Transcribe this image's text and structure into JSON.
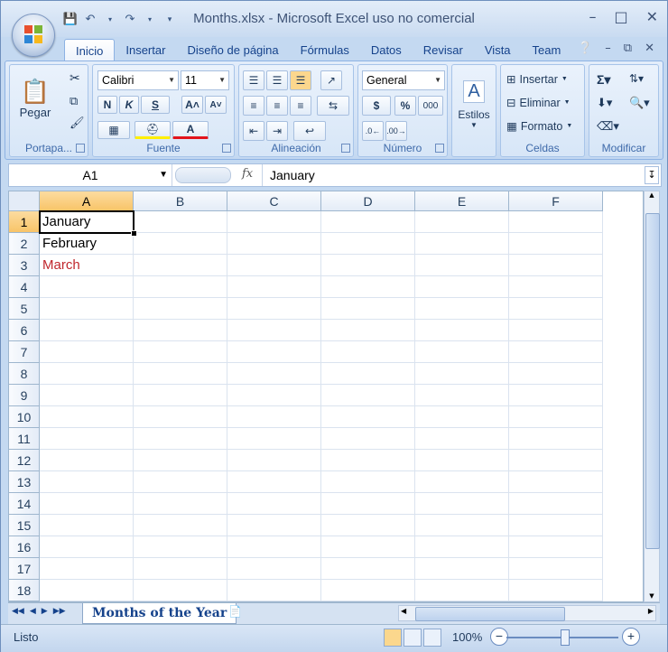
{
  "window": {
    "title": "Months.xlsx - Microsoft Excel uso no comercial",
    "controls": [
      "–",
      "□",
      "✕"
    ]
  },
  "qat": {
    "save_icon": "save-icon",
    "undo_icon": "undo-icon",
    "redo_icon": "redo-icon"
  },
  "tabs": [
    {
      "label": "Inicio",
      "active": true
    },
    {
      "label": "Insertar"
    },
    {
      "label": "Diseño de página"
    },
    {
      "label": "Fórmulas"
    },
    {
      "label": "Datos"
    },
    {
      "label": "Revisar"
    },
    {
      "label": "Vista"
    },
    {
      "label": "Team"
    }
  ],
  "ribbon": {
    "clipboard": {
      "label": "Portapa...",
      "paste": "Pegar"
    },
    "font": {
      "label": "Fuente",
      "name": "Calibri",
      "size": "11",
      "bold": "N",
      "italic": "K",
      "underline": "S"
    },
    "alignment": {
      "label": "Alineación"
    },
    "number": {
      "label": "Número",
      "format": "General",
      "currency": "$",
      "percent": "%",
      "thousands": "000",
      "inc_decimal": "←,0\n.00",
      "dec_decimal": ",00\n→,0"
    },
    "styles": {
      "label": "Estilos"
    },
    "cells": {
      "label": "Celdas",
      "insert": "Insertar",
      "delete": "Eliminar",
      "format": "Formato"
    },
    "editing": {
      "label": "Modificar"
    }
  },
  "formula_bar": {
    "name_box": "A1",
    "fx": "fx",
    "content": "January"
  },
  "grid": {
    "columns": [
      "A",
      "B",
      "C",
      "D",
      "E",
      "F"
    ],
    "rows": [
      "1",
      "2",
      "3",
      "4",
      "5",
      "6",
      "7",
      "8",
      "9",
      "10",
      "11",
      "12",
      "13",
      "14",
      "15",
      "16",
      "17",
      "18"
    ],
    "cells": {
      "A1": "January",
      "A2": "February",
      "A3": "March"
    },
    "accent_color_a3": "#c0272d"
  },
  "sheets": {
    "active": "Months of the Year"
  },
  "status": {
    "text": "Listo",
    "zoom": "100%"
  }
}
